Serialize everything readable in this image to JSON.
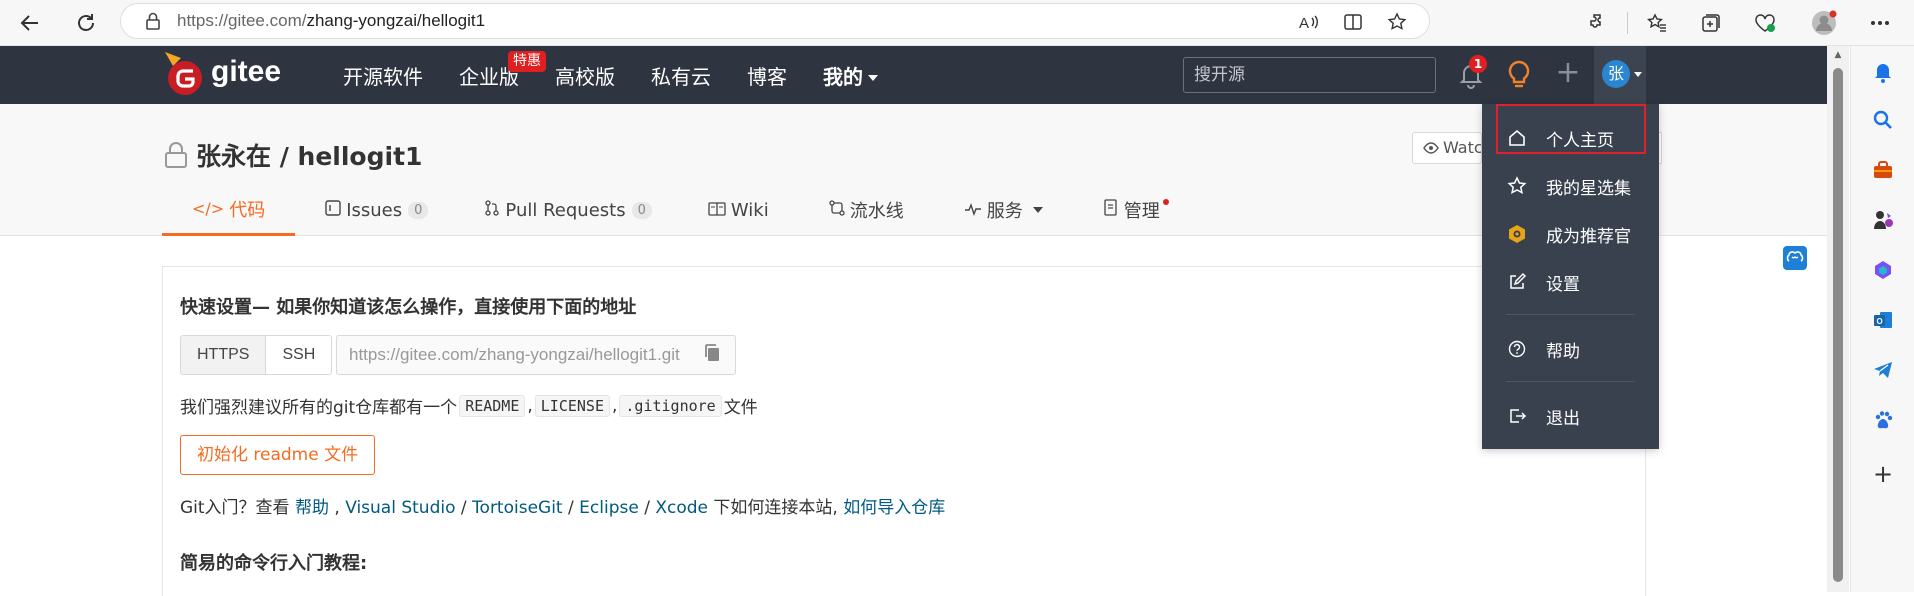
{
  "browser": {
    "url_prefix": "https://gitee.com/",
    "url_path": "zhang-yongzai/hellogit1"
  },
  "gitee_nav": {
    "logo_text": "gitee",
    "items": [
      "开源软件",
      "企业版",
      "高校版",
      "私有云",
      "博客",
      "我的"
    ],
    "tehui_badge": "特惠",
    "search_placeholder": "搜开源",
    "notification_count": "1",
    "avatar_char": "张"
  },
  "project": {
    "title": "张永在 / hellogit1",
    "watch_label": "Watch",
    "tabs": [
      {
        "label": "代码",
        "icon": "code-icon",
        "count": ""
      },
      {
        "label": "Issues",
        "icon": "issues-icon",
        "count": "0"
      },
      {
        "label": "Pull Requests",
        "icon": "pull-request-icon",
        "count": "0"
      },
      {
        "label": "Wiki",
        "icon": "wiki-icon",
        "count": ""
      },
      {
        "label": "流水线",
        "icon": "pipeline-icon",
        "count": ""
      },
      {
        "label": "服务",
        "icon": "service-icon",
        "count": ""
      },
      {
        "label": "管理",
        "icon": "manage-icon",
        "count": ""
      }
    ]
  },
  "quick_setup": {
    "title": "快速设置— 如果你知道该怎么操作，直接使用下面的地址",
    "protocols": [
      "HTTPS",
      "SSH"
    ],
    "clone_url": "https://gitee.com/zhang-yongzai/hellogit1.git",
    "recommend_prefix": "我们强烈建议所有的git仓库都有一个",
    "files": [
      "README",
      "LICENSE",
      ".gitignore"
    ],
    "recommend_suffix": "文件",
    "init_button": "初始化 readme 文件",
    "git_intro_prefix": "Git入门？查看",
    "links": [
      "帮助",
      "Visual Studio",
      "TortoiseGit",
      "Eclipse",
      "Xcode"
    ],
    "git_intro_mid": "下如何连接本站,",
    "import_link": "如何导入仓库",
    "simple_title": "简易的命令行入门教程:"
  },
  "dropdown": {
    "items": [
      {
        "label": "个人主页",
        "icon": "home-icon"
      },
      {
        "label": "我的星选集",
        "icon": "star-icon"
      },
      {
        "label": "成为推荐官",
        "icon": "recommend-icon"
      },
      {
        "label": "设置",
        "icon": "settings-icon"
      },
      {
        "label": "帮助",
        "icon": "help-icon"
      },
      {
        "label": "退出",
        "icon": "logout-icon"
      }
    ]
  },
  "colors": {
    "header_bg": "#2e3440",
    "accent": "#f36c21",
    "link": "#005980",
    "dropdown_bg": "#3a414e",
    "highlight": "#e0202a"
  }
}
